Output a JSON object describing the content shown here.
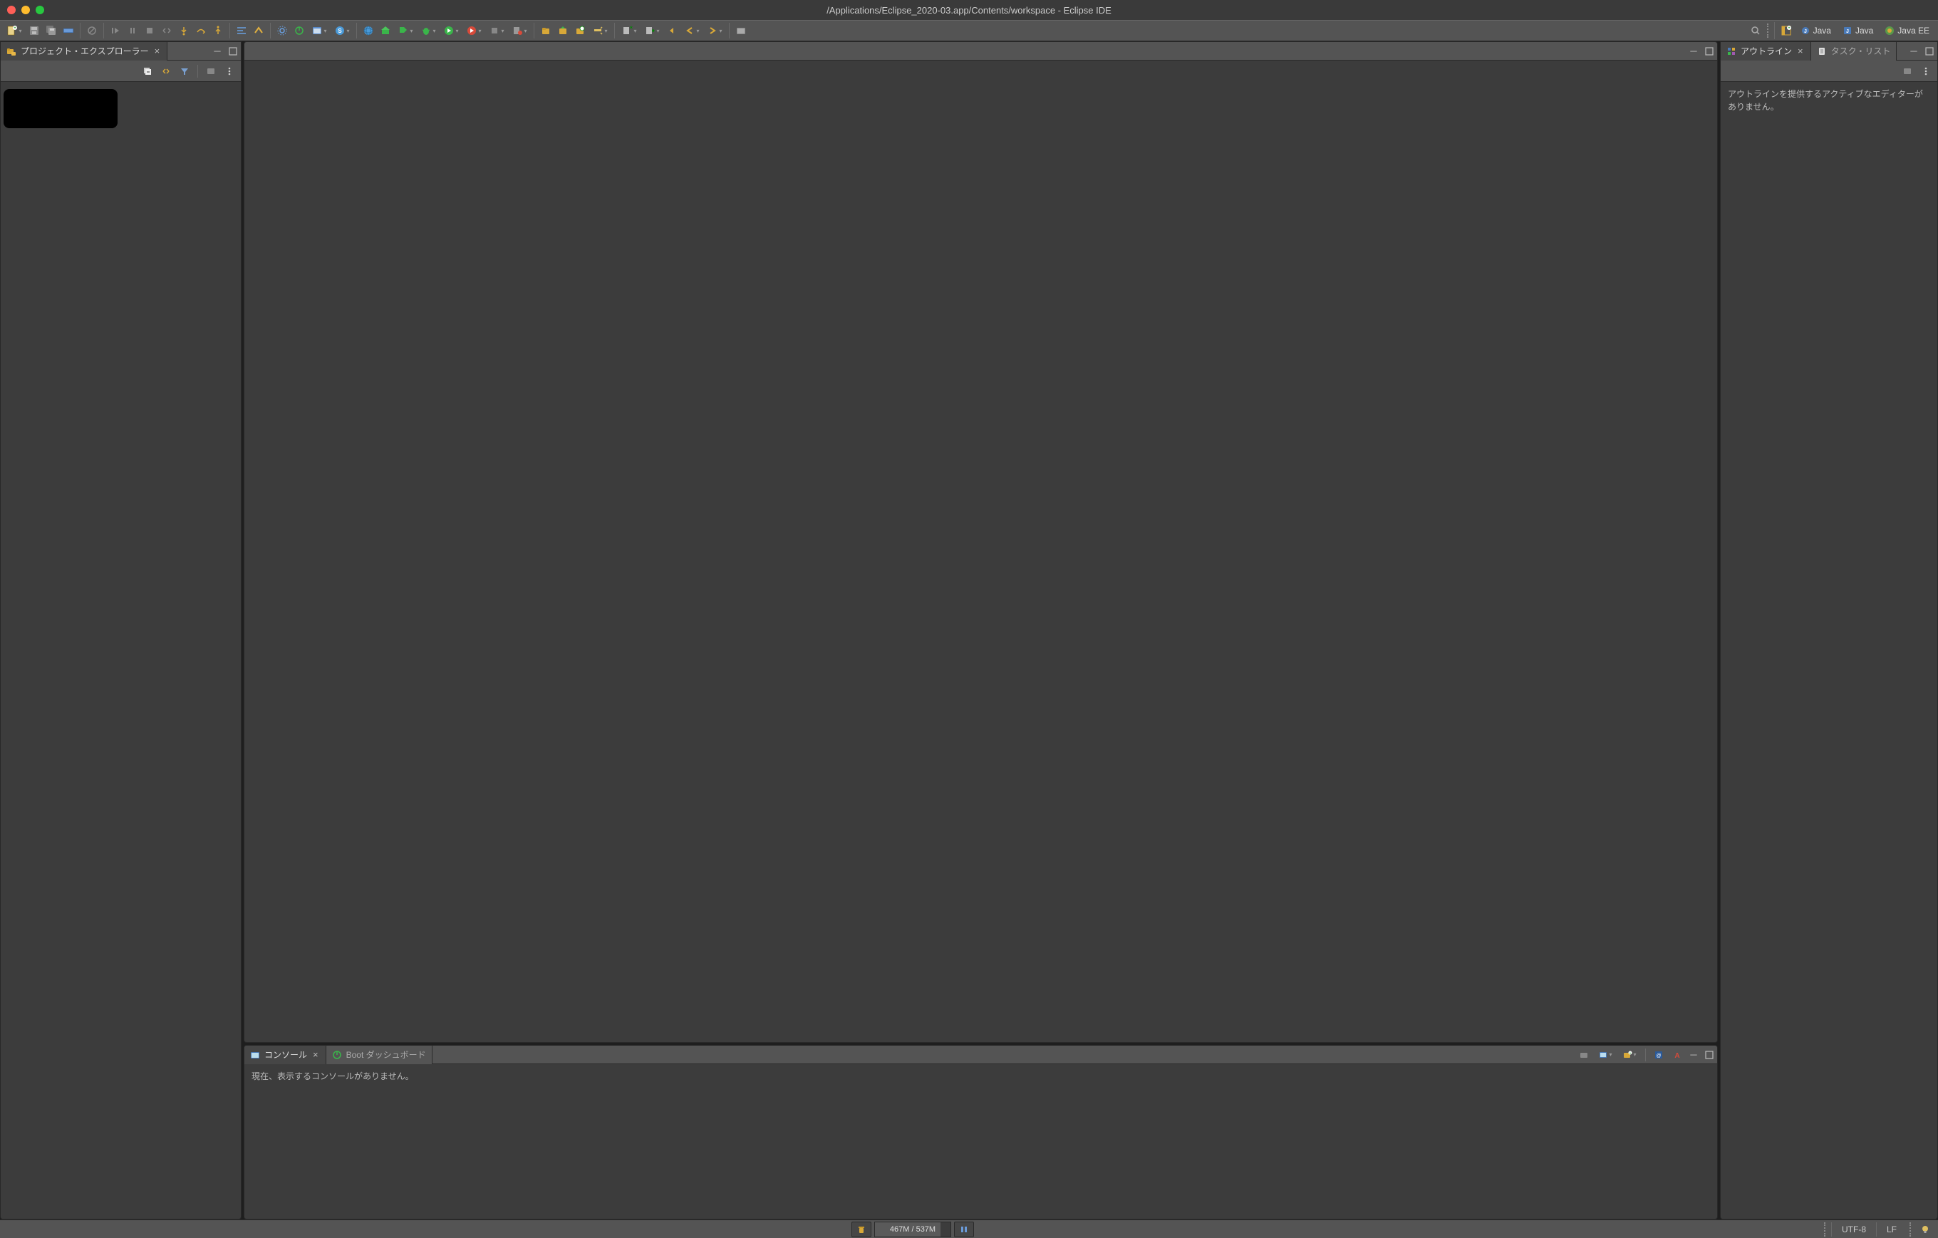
{
  "window": {
    "title": "/Applications/Eclipse_2020-03.app/Contents/workspace - Eclipse IDE"
  },
  "perspectives": {
    "java": "Java",
    "java_alt": "Java",
    "javaee": "Java EE"
  },
  "views": {
    "project_explorer": {
      "title": "プロジェクト・エクスプローラー"
    },
    "outline": {
      "title": "アウトライン",
      "message": "アウトラインを提供するアクティブなエディターがありません。"
    },
    "task_list": {
      "title": "タスク・リスト"
    },
    "console": {
      "title": "コンソール",
      "message": "現在、表示するコンソールがありません。"
    },
    "boot_dashboard": {
      "title": "Boot ダッシュボード"
    }
  },
  "status": {
    "heap": "467M / 537M",
    "encoding": "UTF-8",
    "line_separator": "LF"
  },
  "colors": {
    "bg": "#3c3c3c",
    "toolbar": "#545454",
    "accent_green": "#28c840"
  }
}
